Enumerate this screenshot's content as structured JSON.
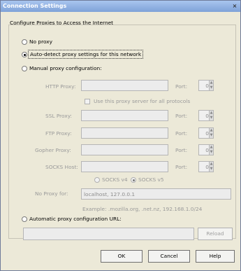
{
  "window": {
    "title": "Connection Settings",
    "close_glyph": "×"
  },
  "group": {
    "title": "Configure Proxies to Access the Internet"
  },
  "options": {
    "no_proxy": "No proxy",
    "auto_detect": "Auto-detect proxy settings for this network",
    "manual": "Manual proxy configuration:",
    "auto_url": "Automatic proxy configuration URL:"
  },
  "manual": {
    "http_label": "HTTP Proxy:",
    "http_value": "",
    "http_port_label": "Port:",
    "http_port": "0",
    "use_same_label": "Use this proxy server for all protocols",
    "ssl_label": "SSL Proxy:",
    "ssl_value": "",
    "ssl_port_label": "Port:",
    "ssl_port": "0",
    "ftp_label": "FTP Proxy:",
    "ftp_value": "",
    "ftp_port_label": "Port:",
    "ftp_port": "0",
    "gopher_label": "Gopher Proxy:",
    "gopher_value": "",
    "gopher_port_label": "Port:",
    "gopher_port": "0",
    "socks_label": "SOCKS Host:",
    "socks_value": "",
    "socks_port_label": "Port:",
    "socks_port": "0",
    "socks_v4": "SOCKS v4",
    "socks_v5": "SOCKS v5",
    "noproxy_label": "No Proxy for:",
    "noproxy_value": "localhost, 127.0.0.1",
    "example": "Example: .mozilla.org, .net.nz, 192.168.1.0/24"
  },
  "auto": {
    "url_value": "",
    "reload": "Reload"
  },
  "buttons": {
    "ok": "OK",
    "cancel": "Cancel",
    "help": "Help"
  },
  "selected_option": "auto_detect",
  "selected_socks": "v5"
}
